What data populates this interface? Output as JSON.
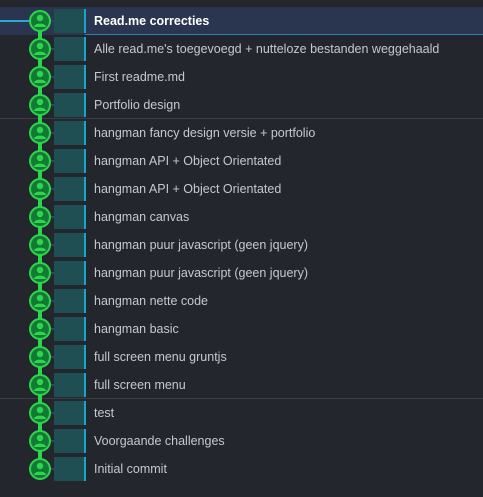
{
  "colors": {
    "panel_bg": "#23262d",
    "selected_bg": "#2a3650",
    "branch_line": "#2fd44e",
    "node_ring": "#2fd44e",
    "node_fill": "#137a33",
    "swatch": "#1f4f52",
    "row_marker": "#17a6c9",
    "text": "#c5c9d0",
    "text_selected": "#ffffff"
  },
  "commits": [
    {
      "message": "Read.me correcties",
      "selected": true,
      "icon": "user-avatar-icon"
    },
    {
      "message": "Alle read.me's toegevoegd + nutteloze bestanden weggehaald",
      "selected": false,
      "icon": "user-avatar-icon"
    },
    {
      "message": "First readme.md",
      "selected": false,
      "icon": "user-avatar-icon"
    },
    {
      "message": "Portfolio design",
      "selected": false,
      "icon": "user-avatar-icon"
    },
    {
      "message": "hangman fancy design versie + portfolio",
      "selected": false,
      "icon": "user-avatar-icon"
    },
    {
      "message": "hangman API + Object Orientated",
      "selected": false,
      "icon": "user-avatar-icon"
    },
    {
      "message": "hangman API + Object Orientated",
      "selected": false,
      "icon": "user-avatar-icon"
    },
    {
      "message": "hangman canvas",
      "selected": false,
      "icon": "user-avatar-icon"
    },
    {
      "message": "hangman puur javascript (geen jquery)",
      "selected": false,
      "icon": "user-avatar-icon"
    },
    {
      "message": "hangman puur javascript (geen jquery)",
      "selected": false,
      "icon": "user-avatar-icon"
    },
    {
      "message": "hangman nette code",
      "selected": false,
      "icon": "user-avatar-icon"
    },
    {
      "message": "hangman basic",
      "selected": false,
      "icon": "user-avatar-icon"
    },
    {
      "message": "full screen menu gruntjs",
      "selected": false,
      "icon": "user-avatar-icon"
    },
    {
      "message": "full screen menu",
      "selected": false,
      "icon": "user-avatar-icon"
    },
    {
      "message": "test",
      "selected": false,
      "icon": "user-avatar-icon"
    },
    {
      "message": "Voorgaande challenges",
      "selected": false,
      "icon": "user-avatar-icon"
    },
    {
      "message": "Initial commit",
      "selected": false,
      "icon": "user-avatar-icon"
    }
  ]
}
